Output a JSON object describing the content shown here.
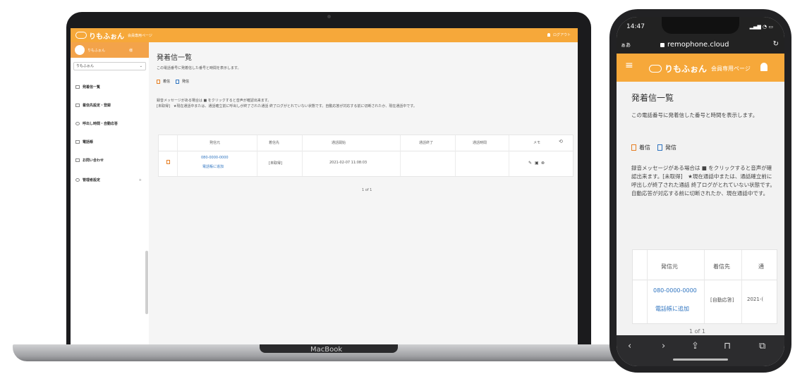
{
  "laptop": {
    "brand_bar": {
      "logo_text": "りもふぉん",
      "logo_sub": "会員専用ページ",
      "logout": "ログアウト"
    },
    "sidebar": {
      "account_name": "りもふぉん",
      "account_badge": "様",
      "selected_account": "りもふぉん",
      "items": [
        {
          "label": "発着信一覧"
        },
        {
          "label": "着信先設定・登録"
        },
        {
          "label": "呼出し時間・自動応答"
        },
        {
          "label": "電話帳"
        },
        {
          "label": "お問い合わせ"
        },
        {
          "label": "管理者設定"
        }
      ]
    },
    "main": {
      "title": "発着信一覧",
      "description": "この電話番号に発着信した番号と時間を表示します。",
      "legend_incoming": "着信",
      "legend_outgoing": "発信",
      "note_line1": "録音メッセージがある場合は ■ をクリックすると音声が確認出来ます。",
      "note_line2": "[未取得]　★現在通話中または、通話確立前に呼出しが終了された通話 終了ログがとれていない状態です。自動応答が対応する前に切断されたか、現在通話中です。",
      "table": {
        "headers": [
          "発信元",
          "着信先",
          "通話開始",
          "通話終了",
          "通話時間",
          "メモ"
        ],
        "row": {
          "from_number": "080-0000-0000",
          "add_to_phonebook": "電話帳に追加",
          "to": "[未取得]",
          "start": "2021-02-07 11:08:03",
          "end": "",
          "duration": ""
        }
      },
      "pager": "1 of 1"
    },
    "macbook_label": "MacBook"
  },
  "phone": {
    "status_time": "14:47",
    "url_aa": "ぁあ",
    "url_host": "remophone.cloud",
    "header": {
      "logo_text": "りもふぉん",
      "logo_sub": "会員専用ページ"
    },
    "title": "発着信一覧",
    "description": "この電話番号に発着信した番号と時間を表示します。",
    "legend_incoming": "着信",
    "legend_outgoing": "発信",
    "note": "録音メッセージがある場合は ■ をクリックすると音声が確認出来ます。[未取得]　★現在通話中または、通話確立前に呼出しが終了された通話 終了ログがとれていない状態です。自動応答が対応する前に切断されたか、現在通話中です。",
    "table": {
      "headers": [
        "発信元",
        "着信先",
        "通"
      ],
      "from_number": "080-0000-0000",
      "add_to_phonebook": "電話帳に追加",
      "to": "[自動応答]",
      "start_partial": "2021-("
    },
    "pager": "1 of 1"
  },
  "colors": {
    "brand_orange": "#f6a83a",
    "link_blue": "#2f74c0",
    "incoming_orange": "#e67e22"
  }
}
